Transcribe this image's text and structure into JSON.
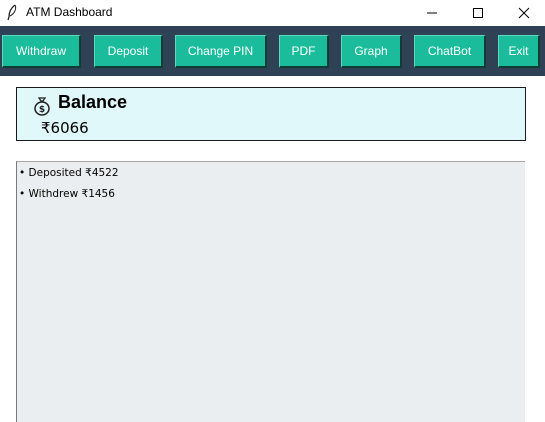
{
  "window": {
    "title": "ATM Dashboard",
    "icon": "feather-icon"
  },
  "toolbar": {
    "buttons": [
      {
        "label": "Withdraw"
      },
      {
        "label": "Deposit"
      },
      {
        "label": "Change PIN"
      },
      {
        "label": "PDF"
      },
      {
        "label": "Graph"
      },
      {
        "label": "ChatBot"
      },
      {
        "label": "Exit"
      }
    ],
    "background": "#2e4155",
    "button_color": "#1abc9c"
  },
  "balance": {
    "icon": "money-bag-icon",
    "title": "Balance",
    "amount": "₹6066",
    "background": "#e0f8f9"
  },
  "history": {
    "items": [
      {
        "text": "• Deposited ₹4522"
      },
      {
        "text": "• Withdrew ₹1456"
      }
    ]
  }
}
